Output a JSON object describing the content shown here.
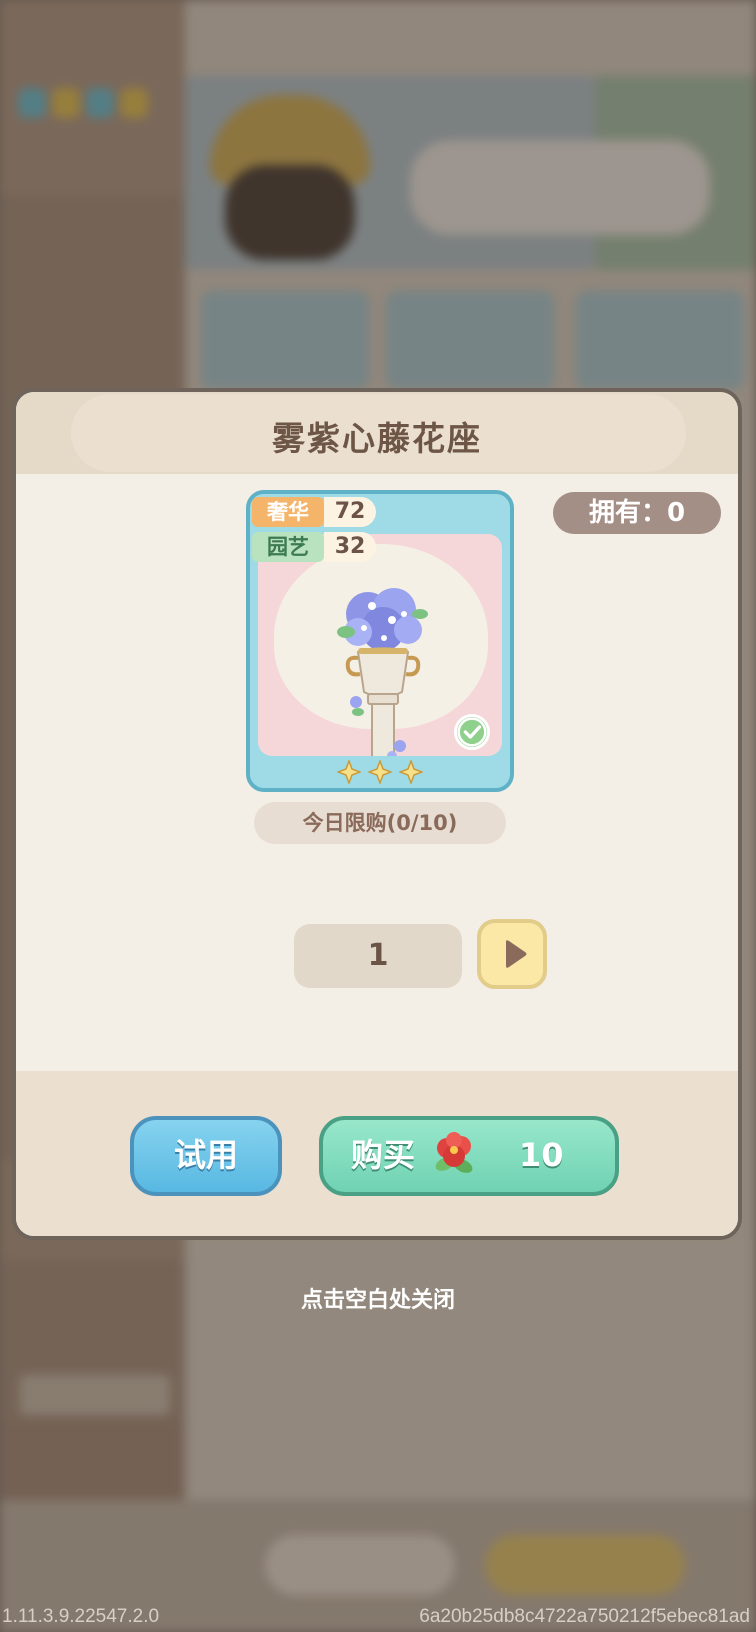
{
  "dialog": {
    "title": "雾紫心藤花座",
    "owned_label": "拥有：0",
    "item": {
      "stats": [
        {
          "label": "奢华",
          "value": "72"
        },
        {
          "label": "园艺",
          "value": "32"
        }
      ],
      "rarity_stars": 3,
      "owned_check": true
    },
    "daily_limit": "今日限购(0/10)",
    "quantity": "1",
    "try_button": "试用",
    "buy_button": {
      "label": "购买",
      "price": "10",
      "currency_icon": "red-camellia-icon"
    }
  },
  "close_hint": "点击空白处关闭",
  "footer": {
    "version": "1.11.3.9.22547.2.0",
    "build_hash": "6a20b25db8c4722a750212f5ebec81ad"
  },
  "colors": {
    "title_text": "#6e5646",
    "try_button": "#58b8e2",
    "buy_button": "#6fd2b2",
    "card_border": "#5fb2c6"
  }
}
